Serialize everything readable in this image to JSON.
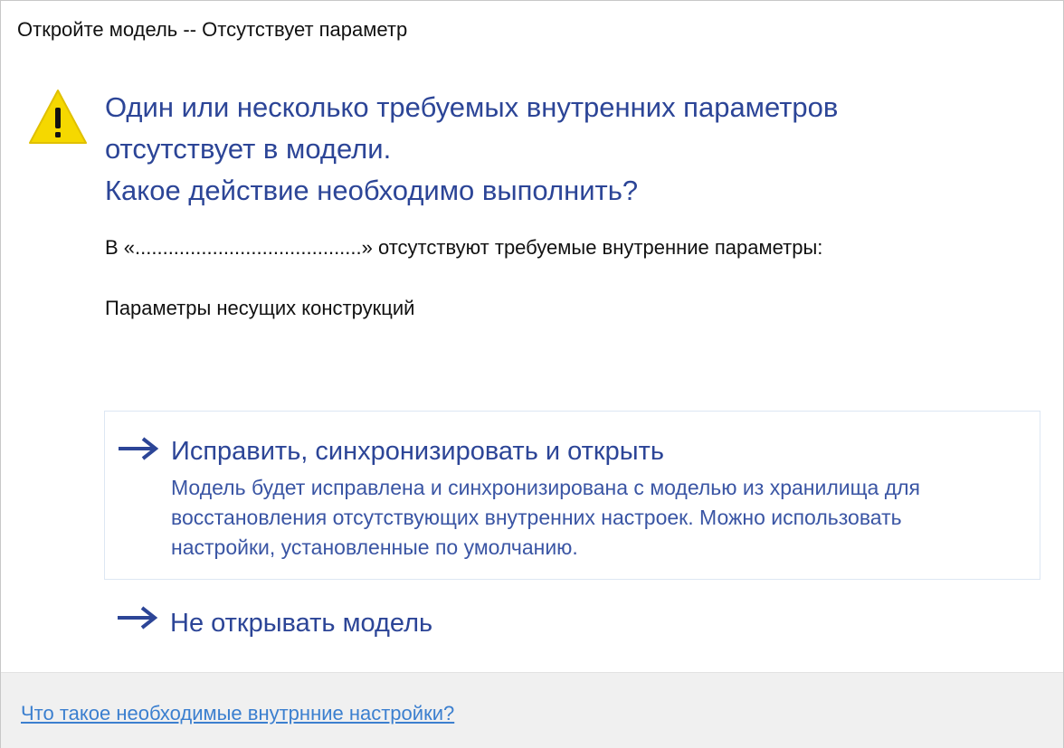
{
  "window": {
    "title": "Откройте модель -- Отсутствует параметр"
  },
  "icon": {
    "name": "warning-icon",
    "color": "#f5d800"
  },
  "main_instruction": {
    "lines": [
      "Один или несколько требуемых внутренних параметров",
      "отсутствует в модели.",
      "Какое действие необходимо выполнить?"
    ]
  },
  "content": {
    "line1": "В «.........................................» отсутствуют требуемые внутренние параметры:",
    "line2": "Параметры несущих конструкций"
  },
  "commands": [
    {
      "title": "Исправить, синхронизировать и открыть",
      "description_lines": [
        "Модель будет исправлена и синхронизирована с моделью из хранилища для",
        "восстановления отсутствующих внутренних настроек. Можно использовать",
        "настройки, установленные по умолчанию."
      ]
    },
    {
      "title": "Не открывать модель"
    }
  ],
  "footer": {
    "link": "Что такое необходимые внутрнние настройки?"
  },
  "colors": {
    "accent": "#2c4597",
    "link": "#3b7fcf",
    "footer_bg": "#f0f0f0"
  }
}
